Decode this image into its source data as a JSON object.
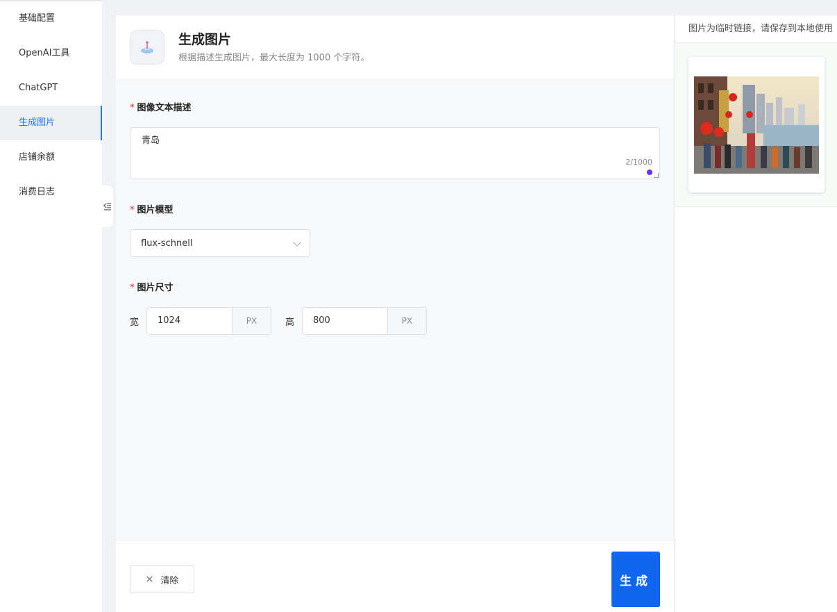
{
  "sidebar": {
    "items": [
      {
        "label": "基础配置"
      },
      {
        "label": "OpenAI工具"
      },
      {
        "label": "ChatGPT"
      },
      {
        "label": "生成图片",
        "active": true
      },
      {
        "label": "店铺余额"
      },
      {
        "label": "消费日志"
      }
    ]
  },
  "header": {
    "title": "生成图片",
    "subtitle": "根据描述生成图片，最大长度为 1000 个字符。"
  },
  "form": {
    "prompt_label": "图像文本描述",
    "prompt_value": "青岛",
    "prompt_count": "2/1000",
    "model_label": "图片模型",
    "model_value": "flux-schnell",
    "size_label": "图片尺寸",
    "width_label": "宽",
    "width_value": "1024",
    "height_label": "高",
    "height_value": "800",
    "unit": "PX",
    "required_mark": "*"
  },
  "footer": {
    "clear_label": "清除",
    "clear_icon": "×",
    "generate_label": "生成"
  },
  "right": {
    "notice": "图片为临时链接，请保存到本地使用"
  },
  "colors": {
    "accent": "#1166f0",
    "required": "#f5222d"
  }
}
